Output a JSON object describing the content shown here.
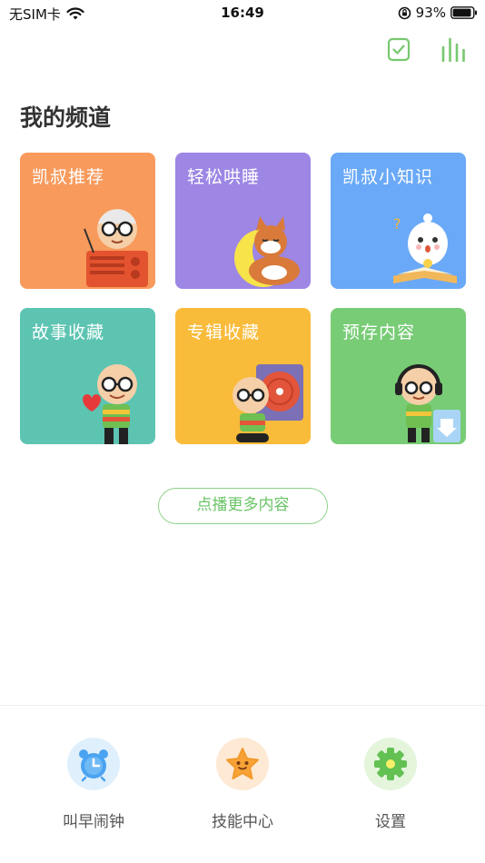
{
  "status_bar": {
    "carrier": "无SIM卡",
    "time": "16:49",
    "battery_percent": "93%",
    "battery_level": 0.93
  },
  "header": {
    "icons": [
      "check-square-icon",
      "bars-icon"
    ]
  },
  "section_title": "我的频道",
  "channels": [
    {
      "label": "凯叔推荐",
      "color": "#f79a5c"
    },
    {
      "label": "轻松哄睡",
      "color": "#9d86e4"
    },
    {
      "label": "凯叔小知识",
      "color": "#6aa9f7"
    },
    {
      "label": "故事收藏",
      "color": "#5dc4b2"
    },
    {
      "label": "专辑收藏",
      "color": "#f9bb3a"
    },
    {
      "label": "预存内容",
      "color": "#78cc76"
    }
  ],
  "more_button": "点播更多内容",
  "bottom_tabs": [
    {
      "label": "叫早闹钟",
      "icon": "alarm-clock-icon",
      "bg": "#dff0fc"
    },
    {
      "label": "技能中心",
      "icon": "star-icon",
      "bg": "#fde9d4"
    },
    {
      "label": "设置",
      "icon": "gear-icon",
      "bg": "#e4f5dc"
    }
  ],
  "colors": {
    "accent_green": "#69c466",
    "title_text": "#333333"
  }
}
